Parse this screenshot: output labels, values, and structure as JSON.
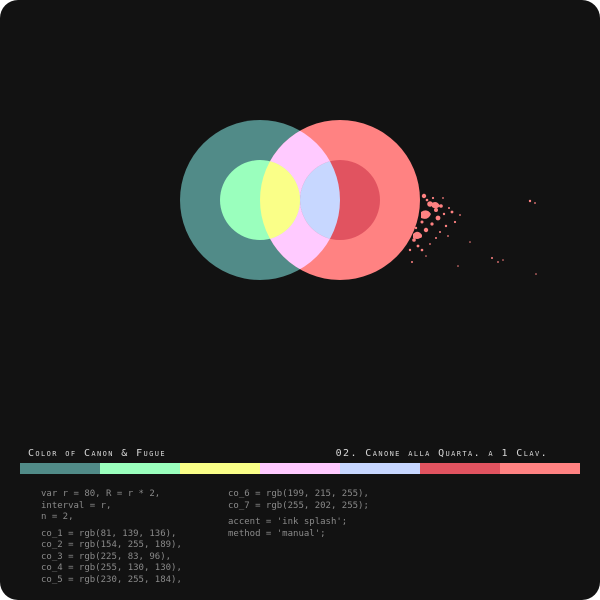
{
  "piece": {
    "title": "Color of Canon & Fugue",
    "subtitle": "02. Canone alla Quarta. a 1 Clav."
  },
  "palette": [
    {
      "name": "co_1",
      "hex": "#518b88"
    },
    {
      "name": "co_2",
      "hex": "#9affbd"
    },
    {
      "name": "co_3",
      "hex": "#e15360"
    },
    {
      "name": "co_4",
      "hex": "#ff8282"
    },
    {
      "name": "co_5",
      "hex": "#e6ffb8"
    },
    {
      "name": "co_6",
      "hex": "#c7d7ff"
    },
    {
      "name": "co_7",
      "hex": "#ffcaff"
    }
  ],
  "bar_order": [
    "#518b88",
    "#9affbd",
    "#faff88",
    "#ffcaff",
    "#c7d7ff",
    "#e15360",
    "#ff8282"
  ],
  "artwork": {
    "left_outer": "#518b88",
    "left_inner": "#9affbd",
    "right_outer": "#ff8282",
    "right_inner": "#e15360",
    "lens_outer": "#ffcaff",
    "lens_inner_left": "#faff88",
    "lens_inner_right": "#c7d7ff",
    "splash": "#ff8282"
  },
  "code": {
    "left_block1": [
      "var r = 80, R = r * 2,",
      "interval = r,",
      "n = 2,"
    ],
    "left_block2": [
      "co_1 = rgb(81, 139, 136),",
      "co_2 = rgb(154, 255, 189),",
      "co_3 = rgb(225, 83, 96),",
      "co_4 = rgb(255, 130, 130),",
      "co_5 = rgb(230, 255, 184),"
    ],
    "right_block1": [
      "co_6 = rgb(199, 215, 255),",
      "co_7 = rgb(255, 202, 255);"
    ],
    "right_block2": [
      "accent = 'ink splash';",
      "method = 'manual';"
    ]
  }
}
